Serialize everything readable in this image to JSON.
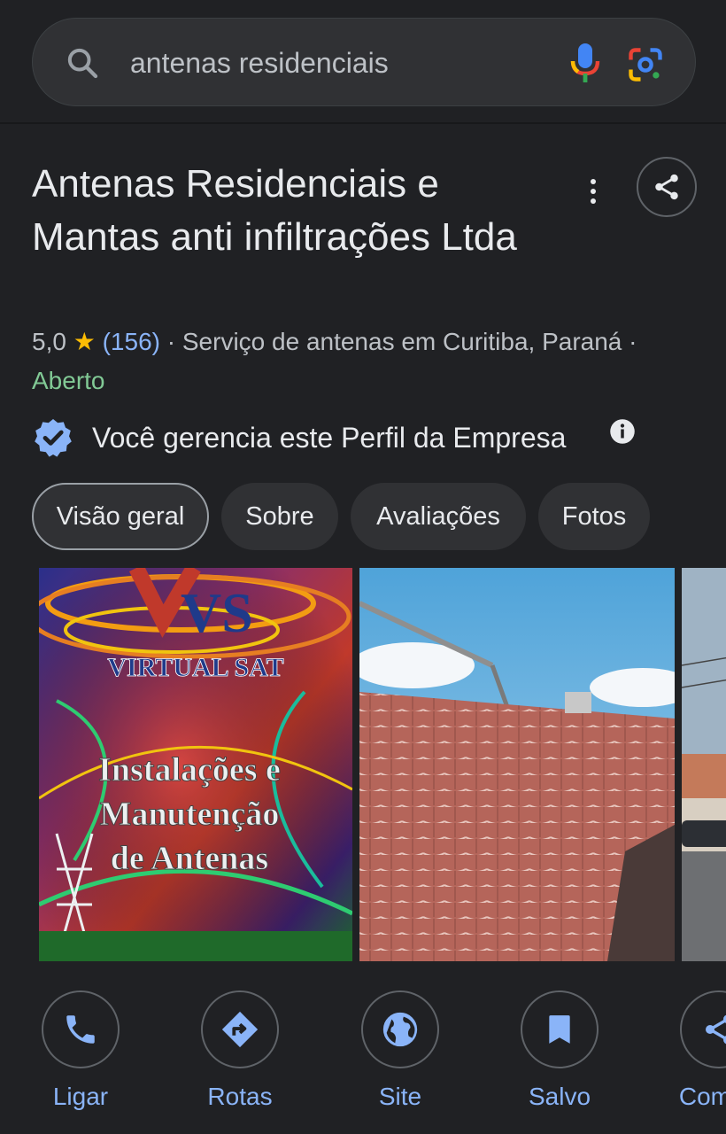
{
  "search": {
    "query": "antenas residenciais",
    "icons": [
      "search-icon",
      "mic-icon",
      "google-lens-icon"
    ]
  },
  "business": {
    "title": "Antenas Residenciais e Mantas anti infiltrações Ltda",
    "rating": "5,0",
    "star": "★",
    "reviews": "(156)",
    "category_location": "· Serviço de antenas em Curitiba, Paraná ·",
    "status": "Aberto",
    "verified_text": "Você gerencia este Perfil da Empresa"
  },
  "tabs": [
    {
      "label": "Visão geral",
      "active": true
    },
    {
      "label": "Sobre",
      "active": false
    },
    {
      "label": "Avaliações",
      "active": false
    },
    {
      "label": "Fotos",
      "active": false
    }
  ],
  "photos": {
    "banner": {
      "logo_letters": "VS",
      "brand": "VIRTUAL SAT",
      "line1": "Instalações e",
      "line2": "Manutenção",
      "line3": "de Antenas"
    }
  },
  "actions": [
    {
      "label": "Ligar",
      "icon": "phone-icon"
    },
    {
      "label": "Rotas",
      "icon": "directions-icon"
    },
    {
      "label": "Site",
      "icon": "globe-icon"
    },
    {
      "label": "Salvo",
      "icon": "bookmark-icon"
    },
    {
      "label": "Compa",
      "icon": "share-icon"
    }
  ],
  "colors": {
    "background": "#202124",
    "link_blue": "#8ab4f8",
    "open_green": "#81c995",
    "star_yellow": "#fbbc04",
    "verified_blue": "#8ab4f8"
  }
}
